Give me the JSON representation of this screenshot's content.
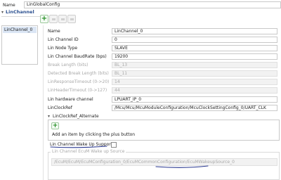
{
  "top": {
    "label": "Name",
    "value": "LinGlobalConfig"
  },
  "section": {
    "title": "LinChannel",
    "collapse_glyph": "▾"
  },
  "toolbar": {
    "add_symbol": "+"
  },
  "tree": {
    "items": [
      {
        "label": "LinChannel_0",
        "selected": true
      }
    ]
  },
  "fields": [
    {
      "label": "Name",
      "value": "LinChannel_0",
      "disabled": false
    },
    {
      "label": "Lin Channel ID",
      "value": "0",
      "disabled": false
    },
    {
      "label": "Lin Node Type",
      "value": "SLAVE",
      "disabled": false
    },
    {
      "label": "Lin Channel BaudRate (bps)",
      "value": "19200",
      "disabled": false
    },
    {
      "label": "Break Length (bits)",
      "value": "BL_13",
      "disabled": true
    },
    {
      "label": "Detected Break Length (bits)",
      "value": "BL_11",
      "disabled": true
    },
    {
      "label": "LinResponseTimeout (0->20)",
      "value": "14",
      "disabled": true
    },
    {
      "label": "LinHeaderTimeout (0->127)",
      "value": "44",
      "disabled": true
    },
    {
      "label": "Lin hardware channel",
      "value": "LPUART_IP_0",
      "disabled": false
    },
    {
      "label": "LinClockRef",
      "value": "/Mcu/Mcu/McuModuleConfiguration/McuClockSettingConfig_0/UART_CLK",
      "disabled": false
    }
  ],
  "alternate": {
    "title": "LinClockRef_Alternate",
    "expand_glyph": "▾",
    "add_hint": "Add an item by clicking the plus button"
  },
  "wakeup": {
    "label": "Lin Channel Wake Up Support",
    "checked": false,
    "source_label": "Lin Channel EcuM Wake up Source",
    "source_value": "/EcuM/EcuM/EcuMConfiguration_0/EcuMCommonConfiguration/EcuMWakeupSource_0"
  },
  "colors": {
    "annotation": "#26358f",
    "add_green": "#1f8a1f",
    "tree_selection": "#dbe6f5"
  },
  "icons": [
    "add-icon",
    "remove-icon",
    "move-up-icon",
    "move-down-icon",
    "collapse-icon",
    "expand-icon"
  ]
}
